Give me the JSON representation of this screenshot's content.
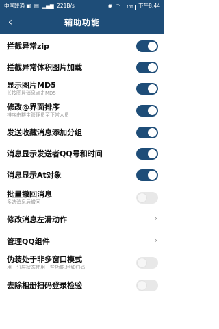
{
  "status_bar": {
    "carrier": "中国联通",
    "net_speed": "221B/s",
    "battery": "100",
    "time": "下午8:44"
  },
  "header": {
    "back_icon": "chevron-left-icon",
    "title": "辅助功能"
  },
  "colors": {
    "accent": "#1e4d78",
    "toggle_off": "#e8e8e8"
  },
  "settings": [
    {
      "label": "拦截异常zip",
      "sub": "",
      "type": "toggle",
      "on": true
    },
    {
      "label": "拦截异常体积图片加载",
      "sub": "",
      "type": "toggle",
      "on": true
    },
    {
      "label": "显示图片MD5",
      "sub": "长按图片消息点击MD5",
      "type": "toggle",
      "on": true
    },
    {
      "label": "修改@界面排序",
      "sub": "排序由群主管理员至正常人员",
      "type": "toggle",
      "on": true
    },
    {
      "label": "发送收藏消息添加分组",
      "sub": "",
      "type": "toggle",
      "on": true
    },
    {
      "label": "消息显示发送者QQ号和时间",
      "sub": "",
      "type": "toggle",
      "on": true
    },
    {
      "label": "消息显示At对象",
      "sub": "",
      "type": "toggle",
      "on": true
    },
    {
      "label": "批量撤回消息",
      "sub": "多选消息后撤回",
      "type": "toggle",
      "on": false
    },
    {
      "label": "修改消息左滑动作",
      "sub": "",
      "type": "link"
    },
    {
      "label": "管理QQ组件",
      "sub": "",
      "type": "link"
    },
    {
      "label": "伪装处于非多窗口模式",
      "sub": "用于分屏状态使用一些功能,例如扫码",
      "type": "toggle",
      "on": false
    },
    {
      "label": "去除相册扫码登录检验",
      "sub": "",
      "type": "toggle",
      "on": false
    }
  ]
}
